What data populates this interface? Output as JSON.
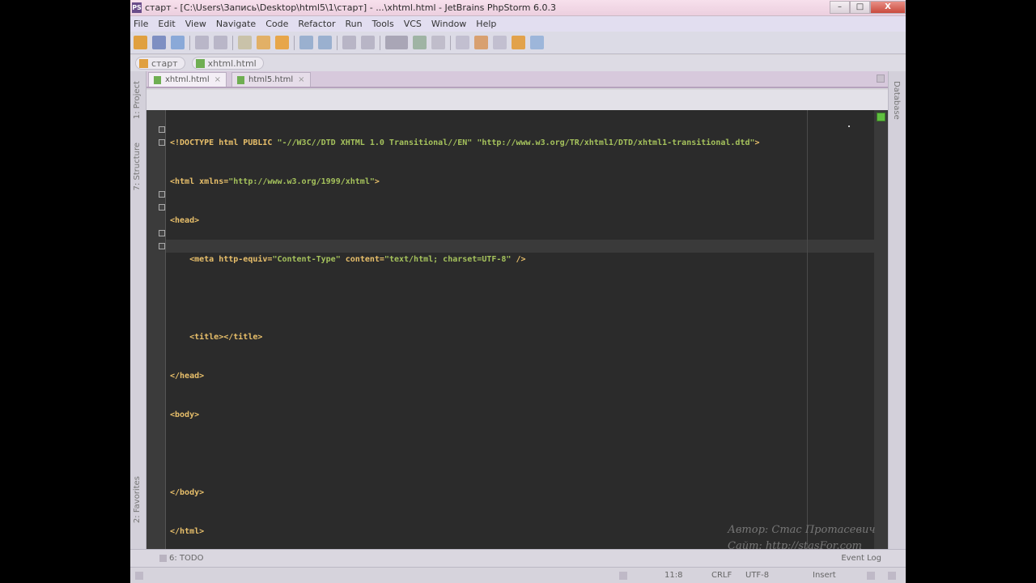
{
  "window": {
    "title": "старт - [C:\\Users\\Запись\\Desktop\\html5\\1\\старт] - ...\\xhtml.html - JetBrains PhpStorm 6.0.3",
    "app_icon": "PS",
    "minimize": "–",
    "maximize": "□",
    "close": "X"
  },
  "menu": [
    "File",
    "Edit",
    "View",
    "Navigate",
    "Code",
    "Refactor",
    "Run",
    "Tools",
    "VCS",
    "Window",
    "Help"
  ],
  "breadcrumbs": [
    "старт",
    "xhtml.html"
  ],
  "tabs": [
    {
      "label": "xhtml.html",
      "active": true
    },
    {
      "label": "html5.html",
      "active": false
    }
  ],
  "tool_windows": {
    "left_top": "1: Project",
    "left_middle": "7: Structure",
    "left_bottom": "2: Favorites",
    "right": "Database"
  },
  "editor": {
    "lines": [
      "<!DOCTYPE html PUBLIC \"-//W3C//DTD XHTML 1.0 Transitional//EN\" \"http://www.w3.org/TR/xhtml1/DTD/xhtml1-transitional.dtd\">",
      "<html xmlns=\"http://www.w3.org/1999/xhtml\">",
      "<head>",
      "    <meta http-equiv=\"Content-Type\" content=\"text/html; charset=UTF-8\" />",
      "",
      "    <title></title>",
      "</head>",
      "<body>",
      "",
      "</body>",
      "</html>"
    ]
  },
  "watermark": {
    "author": "Автор: Стас Протасевич",
    "site": "Сайт: http://stasFor.com"
  },
  "bottom_tools": {
    "todo": "6: TODO",
    "event_log": "Event Log"
  },
  "status": {
    "position": "11:8",
    "line_sep": "CRLF",
    "encoding": "UTF-8",
    "insert": "Insert"
  },
  "colors": {
    "editor_bg": "#2b2b2b",
    "tag": "#e8bf6a",
    "string": "#a5c25c",
    "title_bar": "#f3dbe8",
    "close_button": "#c94a3d"
  }
}
